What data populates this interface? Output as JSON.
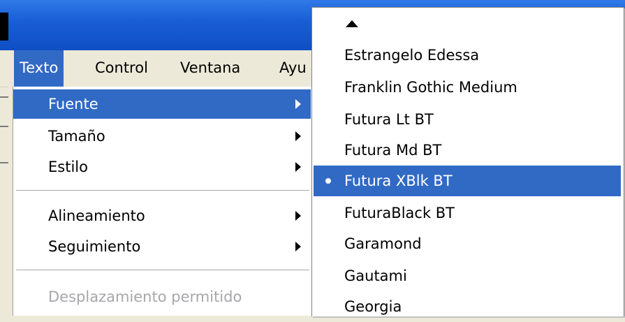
{
  "menubar": {
    "items": [
      {
        "label": "Texto"
      },
      {
        "label": "Control"
      },
      {
        "label": "Ventana"
      },
      {
        "label": "Ayu"
      }
    ]
  },
  "text_menu": {
    "items": [
      {
        "label": "Fuente"
      },
      {
        "label": "Tamaño"
      },
      {
        "label": "Estilo"
      },
      {
        "label": "Alineamiento"
      },
      {
        "label": "Seguimiento"
      },
      {
        "label": "Desplazamiento permitido"
      }
    ]
  },
  "font_submenu": {
    "scroll_up_icon": "up-triangle",
    "selected": "Futura XBlk BT",
    "fonts": [
      {
        "label": "Estrangelo Edessa"
      },
      {
        "label": "Franklin Gothic Medium"
      },
      {
        "label": "Futura Lt BT"
      },
      {
        "label": "Futura Md BT"
      },
      {
        "label": "Futura XBlk BT"
      },
      {
        "label": "FuturaBlack BT"
      },
      {
        "label": "Garamond"
      },
      {
        "label": "Gautami"
      },
      {
        "label": "Georgia"
      }
    ]
  },
  "colors": {
    "highlight": "#316ac5",
    "titlebar": "#1a5fd6",
    "menu_bg": "#ece9d8",
    "disabled_text": "#a7a6aa"
  }
}
